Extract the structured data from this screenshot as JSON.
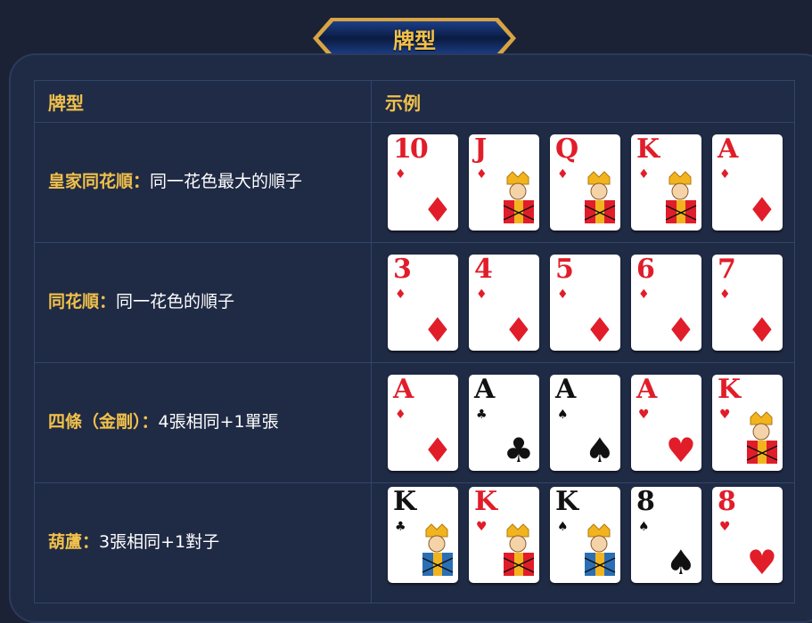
{
  "title": "牌型",
  "table": {
    "col_type": "牌型",
    "col_example": "示例"
  },
  "rows": [
    {
      "name": "皇家同花順",
      "sep": "：",
      "desc": "同一花色最大的順子",
      "cards": [
        {
          "rank": "10",
          "suit": "diamond-icon",
          "glyph": "♦",
          "color": "red",
          "face": false
        },
        {
          "rank": "J",
          "suit": "diamond-icon",
          "glyph": "♦",
          "color": "red",
          "face": true
        },
        {
          "rank": "Q",
          "suit": "diamond-icon",
          "glyph": "♦",
          "color": "red",
          "face": true
        },
        {
          "rank": "K",
          "suit": "diamond-icon",
          "glyph": "♦",
          "color": "red",
          "face": true
        },
        {
          "rank": "A",
          "suit": "diamond-icon",
          "glyph": "♦",
          "color": "red",
          "face": false
        }
      ]
    },
    {
      "name": "同花順",
      "sep": "：",
      "desc": "同一花色的順子",
      "cards": [
        {
          "rank": "3",
          "suit": "diamond-icon",
          "glyph": "♦",
          "color": "red",
          "face": false
        },
        {
          "rank": "4",
          "suit": "diamond-icon",
          "glyph": "♦",
          "color": "red",
          "face": false
        },
        {
          "rank": "5",
          "suit": "diamond-icon",
          "glyph": "♦",
          "color": "red",
          "face": false
        },
        {
          "rank": "6",
          "suit": "diamond-icon",
          "glyph": "♦",
          "color": "red",
          "face": false
        },
        {
          "rank": "7",
          "suit": "diamond-icon",
          "glyph": "♦",
          "color": "red",
          "face": false
        }
      ]
    },
    {
      "name": "四條（金剛）",
      "sep": "：",
      "desc": "4張相同+1單張",
      "cards": [
        {
          "rank": "A",
          "suit": "diamond-icon",
          "glyph": "♦",
          "color": "red",
          "face": false
        },
        {
          "rank": "A",
          "suit": "club-icon",
          "glyph": "♣",
          "color": "black",
          "face": false
        },
        {
          "rank": "A",
          "suit": "spade-icon",
          "glyph": "♠",
          "color": "black",
          "face": false
        },
        {
          "rank": "A",
          "suit": "heart-icon",
          "glyph": "♥",
          "color": "red",
          "face": false
        },
        {
          "rank": "K",
          "suit": "heart-icon",
          "glyph": "♥",
          "color": "red",
          "face": true
        }
      ]
    },
    {
      "name": "葫蘆",
      "sep": "：",
      "desc": "3張相同+1對子",
      "cards": [
        {
          "rank": "K",
          "suit": "club-icon",
          "glyph": "♣",
          "color": "black",
          "face": true
        },
        {
          "rank": "K",
          "suit": "heart-icon",
          "glyph": "♥",
          "color": "red",
          "face": true
        },
        {
          "rank": "K",
          "suit": "spade-icon",
          "glyph": "♠",
          "color": "black",
          "face": true
        },
        {
          "rank": "8",
          "suit": "spade-icon",
          "glyph": "♠",
          "color": "black",
          "face": false
        },
        {
          "rank": "8",
          "suit": "heart-icon",
          "glyph": "♥",
          "color": "red",
          "face": false
        }
      ]
    }
  ],
  "colors": {
    "accent": "#f2c14b",
    "red": "#e11d2a",
    "black": "#111111",
    "background": "#1f2a44"
  }
}
